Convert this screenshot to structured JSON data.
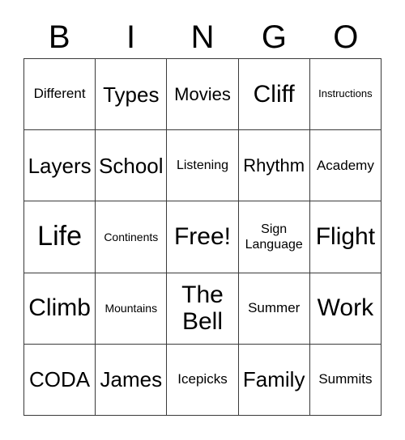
{
  "card": {
    "title": "BINGO",
    "header_letters": [
      "B",
      "I",
      "N",
      "G",
      "O"
    ],
    "columns": 5,
    "rows": 5,
    "free_space": "Free!",
    "free_space_position": {
      "row": 3,
      "column": 3
    },
    "border_color": "#3a3a3a",
    "background_color": "#ffffff",
    "text_color": "#000000",
    "cells": [
      [
        {
          "text": "Different",
          "size": "m"
        },
        {
          "text": "Types",
          "size": "xl"
        },
        {
          "text": "Movies",
          "size": "l"
        },
        {
          "text": "Cliff",
          "size": "2xl"
        },
        {
          "text": "Instructions",
          "size": "xs"
        }
      ],
      [
        {
          "text": "Layers",
          "size": "xl"
        },
        {
          "text": "School",
          "size": "xl"
        },
        {
          "text": "Listening",
          "size": "sm"
        },
        {
          "text": "Rhythm",
          "size": "l"
        },
        {
          "text": "Academy",
          "size": "m"
        }
      ],
      [
        {
          "text": "Life",
          "size": "3xl"
        },
        {
          "text": "Continents",
          "size": "s"
        },
        {
          "text": "Free!",
          "size": "2xl"
        },
        {
          "text": "Sign Language",
          "size": "sm"
        },
        {
          "text": "Flight",
          "size": "2xl"
        }
      ],
      [
        {
          "text": "Climb",
          "size": "2xl"
        },
        {
          "text": "Mountains",
          "size": "s"
        },
        {
          "text": "The Bell",
          "size": "2xl"
        },
        {
          "text": "Summer",
          "size": "m"
        },
        {
          "text": "Work",
          "size": "2xl"
        }
      ],
      [
        {
          "text": "CODA",
          "size": "xl"
        },
        {
          "text": "James",
          "size": "xl"
        },
        {
          "text": "Icepicks",
          "size": "m"
        },
        {
          "text": "Family",
          "size": "xl"
        },
        {
          "text": "Summits",
          "size": "m"
        }
      ]
    ]
  }
}
